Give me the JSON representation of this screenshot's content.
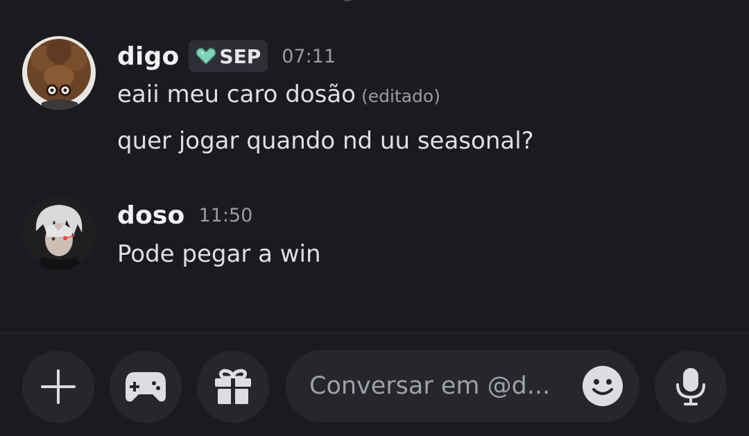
{
  "messages": [
    {
      "username": "digo",
      "tag": "SEP",
      "timestamp": "07:11",
      "lines": [
        "eaii meu caro dosão",
        "quer jogar quando nd uu seasonal?"
      ],
      "edited_label": "(editado)"
    },
    {
      "username": "doso",
      "timestamp": "11:50",
      "lines": [
        "Pode pegar a win"
      ]
    }
  ],
  "composer": {
    "placeholder": "Conversar em @d..."
  },
  "icons": {
    "add": "plus-icon",
    "games": "gamepad-icon",
    "gift": "gift-icon",
    "emoji": "smile-icon",
    "voice": "microphone-icon",
    "tag": "heart-gem-icon"
  },
  "colors": {
    "background": "#1b1b1f",
    "button": "#26272d",
    "tag_bg": "#2e2f36",
    "tag_heart": "#7fd3b6"
  }
}
